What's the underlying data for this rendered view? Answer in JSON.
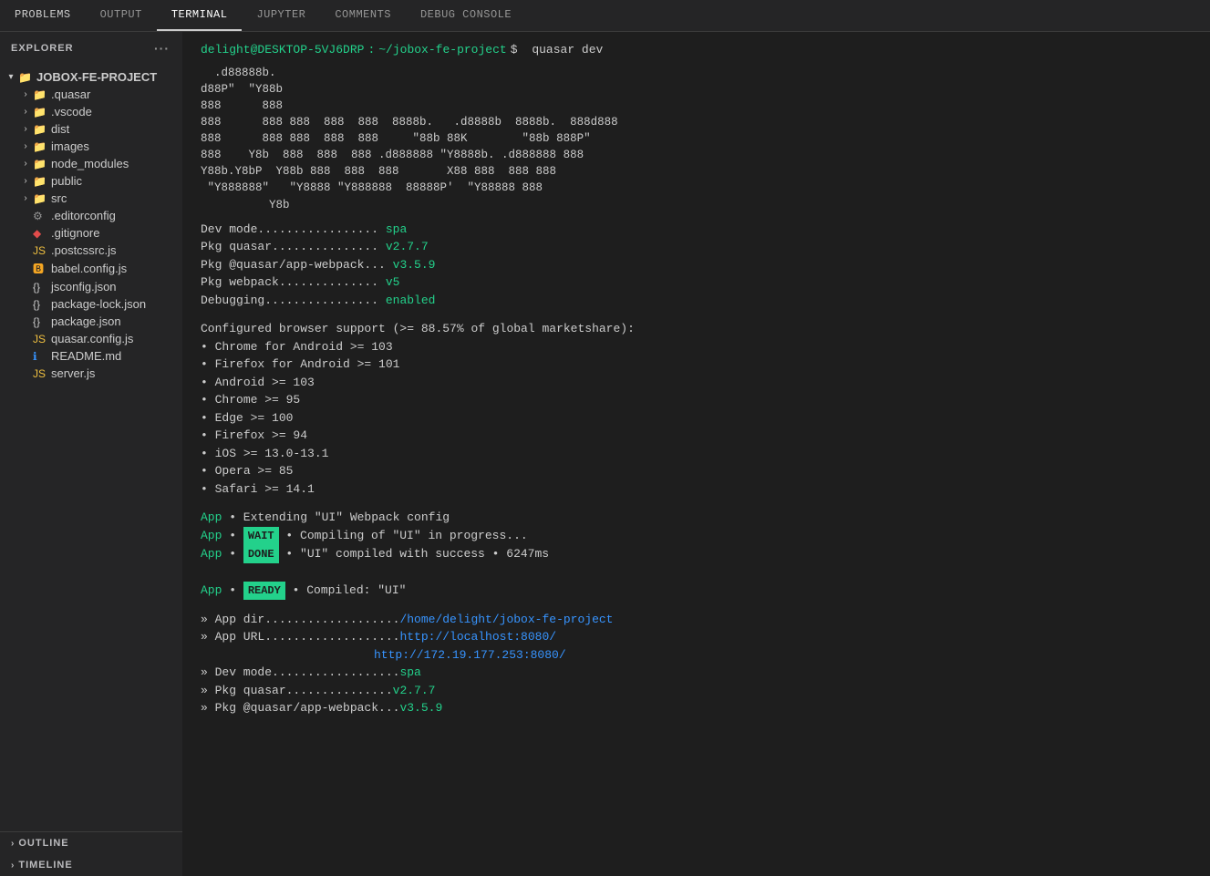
{
  "tabs": {
    "items": [
      {
        "label": "PROBLEMS",
        "active": false
      },
      {
        "label": "OUTPUT",
        "active": false
      },
      {
        "label": "TERMINAL",
        "active": true
      },
      {
        "label": "JUPYTER",
        "active": false
      },
      {
        "label": "COMMENTS",
        "active": false
      },
      {
        "label": "DEBUG CONSOLE",
        "active": false
      }
    ]
  },
  "sidebar": {
    "explorer_label": "EXPLORER",
    "project_name": "JOBOX-FE-PROJECT",
    "files": [
      {
        "name": ".quasar",
        "type": "folder",
        "indent": 0
      },
      {
        "name": ".vscode",
        "type": "folder",
        "indent": 0
      },
      {
        "name": "dist",
        "type": "folder",
        "indent": 0
      },
      {
        "name": "images",
        "type": "folder",
        "indent": 0
      },
      {
        "name": "node_modules",
        "type": "folder",
        "indent": 0
      },
      {
        "name": "public",
        "type": "folder",
        "indent": 0
      },
      {
        "name": "src",
        "type": "folder",
        "indent": 0
      },
      {
        "name": ".editorconfig",
        "type": "gear",
        "indent": 0
      },
      {
        "name": ".gitignore",
        "type": "git",
        "indent": 0
      },
      {
        "name": ".postcssrc.js",
        "type": "js",
        "indent": 0
      },
      {
        "name": "babel.config.js",
        "type": "babel",
        "indent": 0
      },
      {
        "name": "jsconfig.json",
        "type": "json",
        "indent": 0
      },
      {
        "name": "package-lock.json",
        "type": "json",
        "indent": 0
      },
      {
        "name": "package.json",
        "type": "json",
        "indent": 0
      },
      {
        "name": "quasar.config.js",
        "type": "js",
        "indent": 0
      },
      {
        "name": "README.md",
        "type": "info",
        "indent": 0
      },
      {
        "name": "server.js",
        "type": "js",
        "indent": 0
      }
    ],
    "bottom": [
      {
        "label": "OUTLINE"
      },
      {
        "label": "TIMELINE"
      }
    ]
  },
  "terminal": {
    "prompt_user": "delight@DESKTOP-5VJ6DRP",
    "prompt_path": "~/jobox-fe-project",
    "prompt_cmd": "quasar dev",
    "quasar_logo": "  .d88888b.\nd88P\"  \"Y88b\n888      888\n888      888 888  888  888  8888b.   .d8888b  8888b.  888d888\n888      888 888  888  888     \"88b 88K        \"88b 888P\"\n888    Y8b  888  888  888 .d888888 \"Y8888b. .d888888 888\nY88b.Y8bP  Y88b 888  888  888       X88 888  888 888\n \"Y888888\"   \"Y8888 \"Y888888  88888P'  \"Y88888 888\n          Y8b",
    "dev_mode": "spa",
    "pkg_quasar": "v2.7.7",
    "pkg_app_webpack": "v3.5.9",
    "pkg_webpack": "v5",
    "debugging": "enabled",
    "browser_support_header": "Configured browser support (>= 88.57% of global marketshare):",
    "browser_list": [
      "Chrome for Android >= 103",
      "Firefox for Android >= 101",
      "Android >= 103",
      "Chrome >= 95",
      "Edge >= 100",
      "Firefox >= 94",
      "iOS >= 13.0-13.1",
      "Opera >= 85",
      "Safari >= 14.1"
    ],
    "app_extending": "App • Extending \"UI\" Webpack config",
    "wait_label": "WAIT",
    "wait_text": "• Compiling of \"UI\" in progress...",
    "done_label": "DONE",
    "done_text": "• \"UI\" compiled with success • 6247ms",
    "ready_label": "READY",
    "ready_text": "• Compiled: \"UI\"",
    "app_dir_label": "» App dir...................",
    "app_dir_value": "/home/delight/jobox-fe-project",
    "app_url_label": "» App URL...................",
    "app_url_value1": "http://localhost:8080/",
    "app_url_value2": "http://172.19.177.253:8080/",
    "dev_mode2_label": "» Dev mode..................",
    "dev_mode2_value": "spa",
    "pkg_quasar2_label": "» Pkg quasar...............",
    "pkg_quasar2_value": "v2.7.7",
    "pkg_appwebpack2_label": "» Pkg @quasar/app-webpack...",
    "pkg_appwebpack2_value": "v3.5.9"
  }
}
